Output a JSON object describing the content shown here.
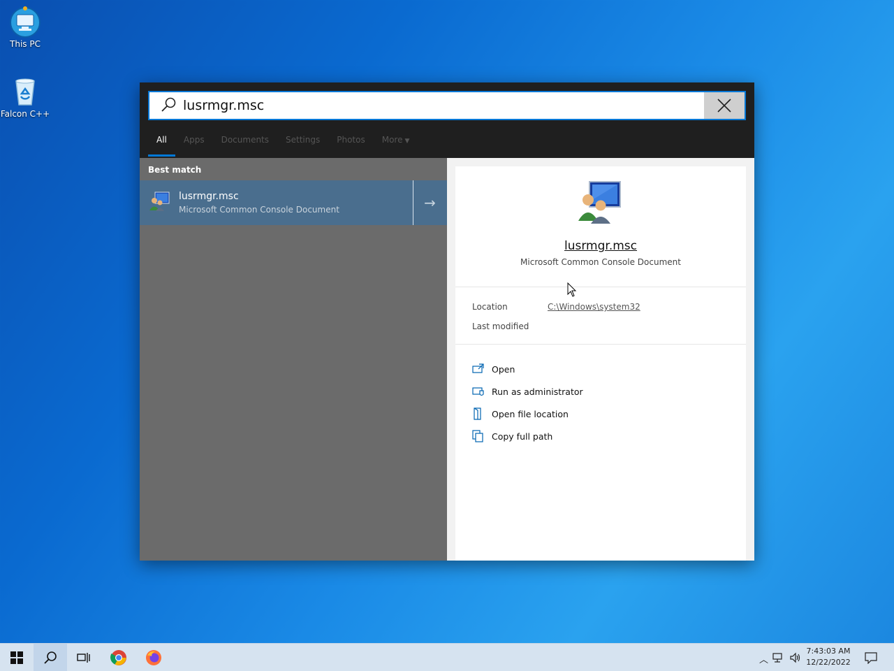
{
  "desktop": {
    "icons": [
      {
        "label": "This PC"
      },
      {
        "label": "Falcon C++"
      }
    ]
  },
  "search": {
    "query": "lusrmgr.msc",
    "tabs": [
      {
        "label": "All"
      },
      {
        "label": "Apps"
      },
      {
        "label": "Documents"
      },
      {
        "label": "Settings"
      },
      {
        "label": "Photos"
      },
      {
        "label": "More"
      }
    ],
    "best_match_label": "Best match",
    "result": {
      "title": "lusrmgr.msc",
      "subtitle": "Microsoft Common Console Document"
    },
    "detail": {
      "name": "lusrmgr.msc",
      "kind": "Microsoft Common Console Document",
      "location_label": "Location",
      "location_value": "C:\\Windows\\system32",
      "modified_label": "Last modified",
      "actions": [
        {
          "label": "Open"
        },
        {
          "label": "Run as administrator"
        },
        {
          "label": "Open file location"
        },
        {
          "label": "Copy full path"
        }
      ]
    }
  },
  "taskbar": {
    "time": "7:43:03 AM",
    "date": "12/22/2022"
  },
  "colors": {
    "accent": "#0078d7",
    "selected_result": "#4a6e8e"
  }
}
